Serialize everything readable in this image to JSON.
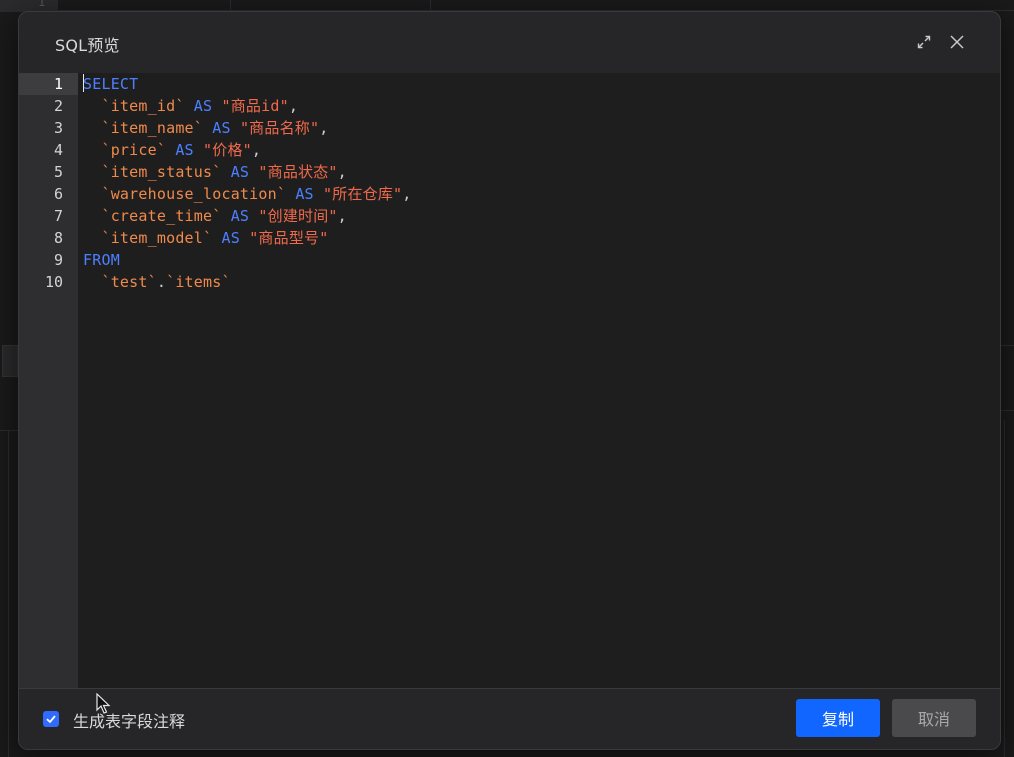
{
  "background": {
    "gutter_line_number": "1"
  },
  "dialog": {
    "title": "SQL预览",
    "expand_icon": "expand-icon",
    "close_icon": "close-icon"
  },
  "editor": {
    "active_line": 1,
    "line_numbers": [
      "1",
      "2",
      "3",
      "4",
      "5",
      "6",
      "7",
      "8",
      "9",
      "10"
    ],
    "lines": [
      [
        {
          "t": "kw",
          "v": "SELECT"
        }
      ],
      [
        {
          "t": "pun",
          "v": "  "
        },
        {
          "t": "id",
          "v": "`item_id`"
        },
        {
          "t": "pun",
          "v": " "
        },
        {
          "t": "kw",
          "v": "AS"
        },
        {
          "t": "pun",
          "v": " "
        },
        {
          "t": "str",
          "v": "\"商品id\""
        },
        {
          "t": "pun",
          "v": ","
        }
      ],
      [
        {
          "t": "pun",
          "v": "  "
        },
        {
          "t": "id",
          "v": "`item_name`"
        },
        {
          "t": "pun",
          "v": " "
        },
        {
          "t": "kw",
          "v": "AS"
        },
        {
          "t": "pun",
          "v": " "
        },
        {
          "t": "str",
          "v": "\"商品名称\""
        },
        {
          "t": "pun",
          "v": ","
        }
      ],
      [
        {
          "t": "pun",
          "v": "  "
        },
        {
          "t": "id",
          "v": "`price`"
        },
        {
          "t": "pun",
          "v": " "
        },
        {
          "t": "kw",
          "v": "AS"
        },
        {
          "t": "pun",
          "v": " "
        },
        {
          "t": "str",
          "v": "\"价格\""
        },
        {
          "t": "pun",
          "v": ","
        }
      ],
      [
        {
          "t": "pun",
          "v": "  "
        },
        {
          "t": "id",
          "v": "`item_status`"
        },
        {
          "t": "pun",
          "v": " "
        },
        {
          "t": "kw",
          "v": "AS"
        },
        {
          "t": "pun",
          "v": " "
        },
        {
          "t": "str",
          "v": "\"商品状态\""
        },
        {
          "t": "pun",
          "v": ","
        }
      ],
      [
        {
          "t": "pun",
          "v": "  "
        },
        {
          "t": "id",
          "v": "`warehouse_location`"
        },
        {
          "t": "pun",
          "v": " "
        },
        {
          "t": "kw",
          "v": "AS"
        },
        {
          "t": "pun",
          "v": " "
        },
        {
          "t": "str",
          "v": "\"所在仓库\""
        },
        {
          "t": "pun",
          "v": ","
        }
      ],
      [
        {
          "t": "pun",
          "v": "  "
        },
        {
          "t": "id",
          "v": "`create_time`"
        },
        {
          "t": "pun",
          "v": " "
        },
        {
          "t": "kw",
          "v": "AS"
        },
        {
          "t": "pun",
          "v": " "
        },
        {
          "t": "str",
          "v": "\"创建时间\""
        },
        {
          "t": "pun",
          "v": ","
        }
      ],
      [
        {
          "t": "pun",
          "v": "  "
        },
        {
          "t": "id",
          "v": "`item_model`"
        },
        {
          "t": "pun",
          "v": " "
        },
        {
          "t": "kw",
          "v": "AS"
        },
        {
          "t": "pun",
          "v": " "
        },
        {
          "t": "str",
          "v": "\"商品型号\""
        }
      ],
      [
        {
          "t": "kw",
          "v": "FROM"
        }
      ],
      [
        {
          "t": "pun",
          "v": "  "
        },
        {
          "t": "id",
          "v": "`test`"
        },
        {
          "t": "pun",
          "v": "."
        },
        {
          "t": "id",
          "v": "`items`"
        }
      ]
    ]
  },
  "footer": {
    "checkbox_checked": true,
    "checkbox_label": "生成表字段注释",
    "copy_label": "复制",
    "cancel_label": "取消"
  },
  "colors": {
    "keyword": "#4c80ff",
    "identifier": "#f08a4b",
    "string": "#f06a4b",
    "primary_button": "#1166ff",
    "checkbox": "#2f6bff"
  }
}
